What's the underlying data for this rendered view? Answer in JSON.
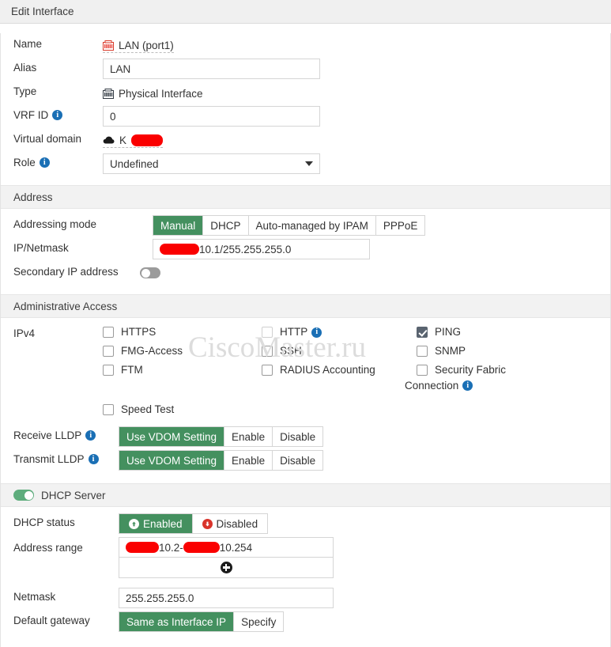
{
  "window": {
    "title": "Edit Interface"
  },
  "watermark": {
    "text": "CiscoMaster.ru"
  },
  "interface": {
    "name_label": "Name",
    "name_value": "LAN (port1)",
    "name_icon": "network-port-icon",
    "alias_label": "Alias",
    "alias_value": "LAN",
    "alias_placeholder": "",
    "type_label": "Type",
    "type_value": "Physical Interface",
    "type_icon": "network-port-icon",
    "vrf_label": "VRF ID",
    "vrf_value": "0",
    "vdom_label": "Virtual domain",
    "vdom_value": "K",
    "vdom_icon": "cloud-icon",
    "role_label": "Role",
    "role_value": "Undefined"
  },
  "address": {
    "section_title": "Address",
    "mode_label": "Addressing mode",
    "mode_options": [
      "Manual",
      "DHCP",
      "Auto-managed by IPAM",
      "PPPoE"
    ],
    "mode_selected": "Manual",
    "ip_label": "IP/Netmask",
    "ip_value": "10.1/255.255.255.0",
    "secondary_label": "Secondary IP address",
    "secondary_enabled": false
  },
  "admin_access": {
    "section_title": "Administrative Access",
    "ipv4_label": "IPv4",
    "column1": [
      {
        "label": "HTTPS",
        "checked": false,
        "dim": false,
        "info": false
      },
      {
        "label": "FMG-Access",
        "checked": false,
        "dim": false,
        "info": false
      },
      {
        "label": "FTM",
        "checked": false,
        "dim": false,
        "info": false
      }
    ],
    "column2": [
      {
        "label": "HTTP",
        "checked": false,
        "dim": true,
        "info": true
      },
      {
        "label": "SSH",
        "checked": false,
        "dim": false,
        "info": false
      },
      {
        "label": "RADIUS Accounting",
        "checked": false,
        "dim": false,
        "info": false
      }
    ],
    "column3": [
      {
        "label": "PING",
        "checked": true,
        "dim": false,
        "info": false
      },
      {
        "label": "SNMP",
        "checked": false,
        "dim": false,
        "info": false
      },
      {
        "label": "Security Fabric",
        "checked": false,
        "dim": false,
        "info": false
      }
    ],
    "column3_wrap": "Connection",
    "speed_test": {
      "label": "Speed Test",
      "checked": false
    },
    "receive_lldp_label": "Receive LLDP",
    "transmit_lldp_label": "Transmit LLDP",
    "lldp_options": [
      "Use VDOM Setting",
      "Enable",
      "Disable"
    ],
    "lldp_selected": "Use VDOM Setting"
  },
  "dhcp": {
    "section_title": "DHCP Server",
    "server_enabled": true,
    "status_label": "DHCP status",
    "status_options": [
      "Enabled",
      "Disabled"
    ],
    "status_selected": "Enabled",
    "range_label": "Address range",
    "range_start": "10.2-",
    "range_end": "10.254",
    "add_icon": "plus-circle-icon",
    "netmask_label": "Netmask",
    "netmask_value": "255.255.255.0",
    "gateway_label": "Default gateway",
    "gateway_options": [
      "Same as Interface IP",
      "Specify"
    ],
    "gateway_selected": "Same as Interface IP"
  },
  "colors": {
    "accent_green": "#44905f",
    "toggle_green": "#5ead7d",
    "info_blue": "#1a6fb5",
    "redaction_red": "#fa0000",
    "checked_gray": "#5a6470",
    "section_bg": "#f2f2f2"
  }
}
